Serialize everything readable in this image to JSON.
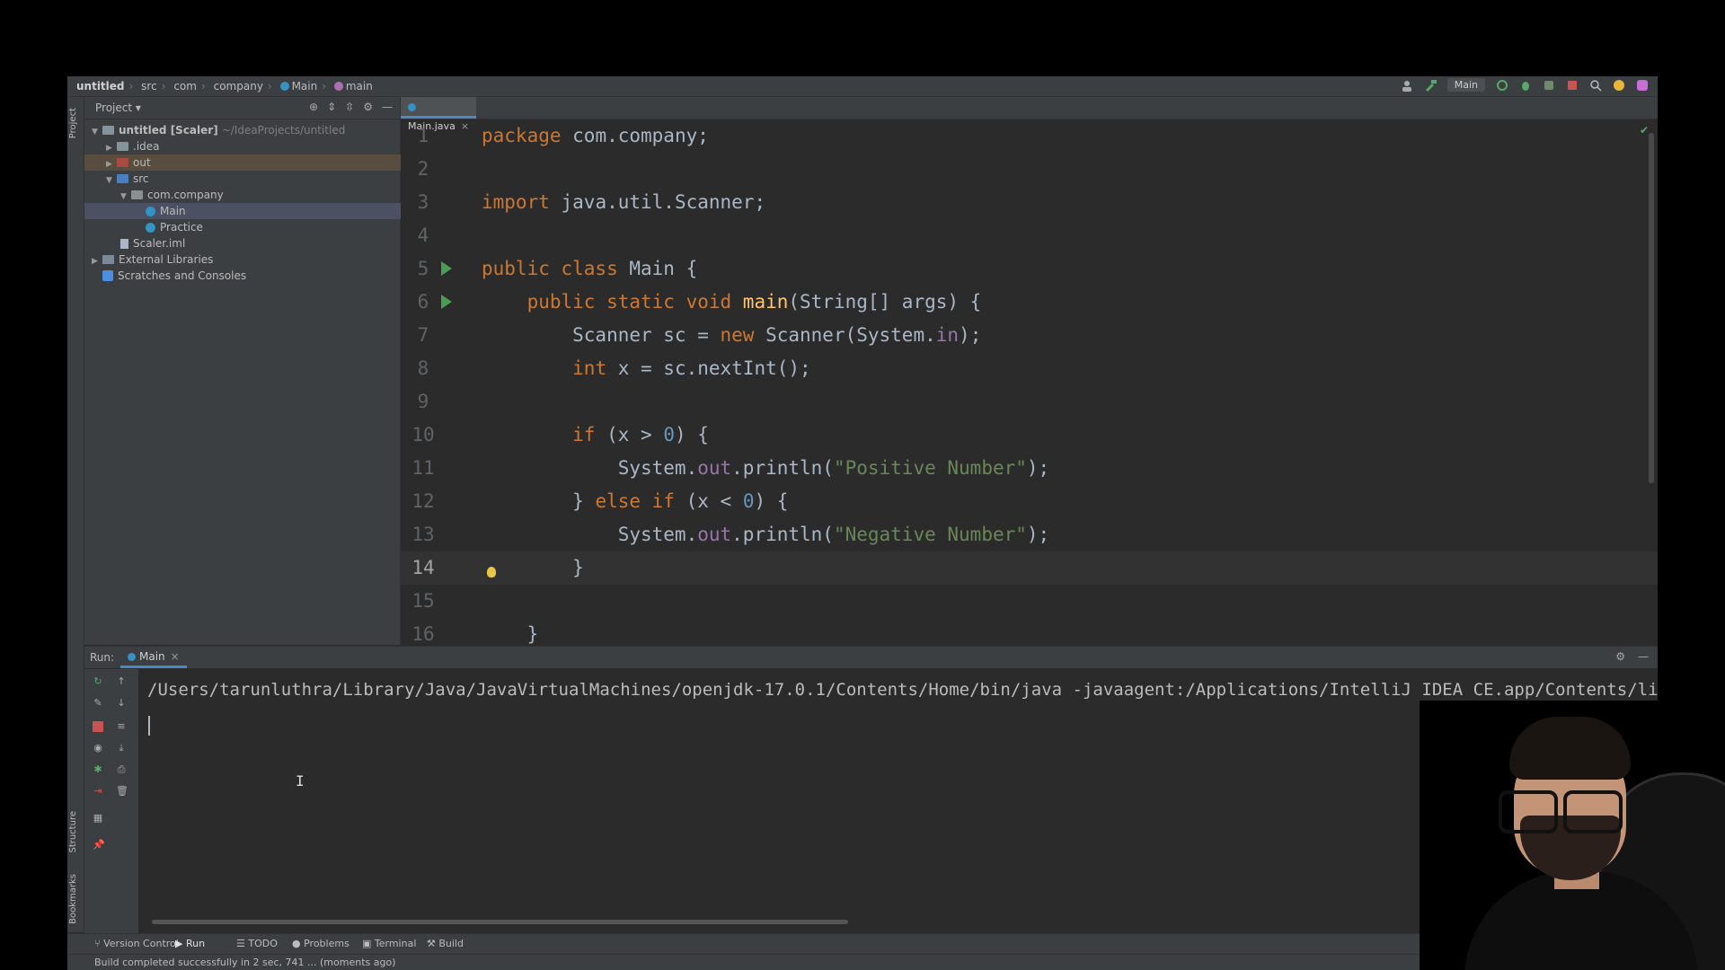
{
  "breadcrumb": [
    "untitled",
    "src",
    "com",
    "company",
    "Main",
    "main"
  ],
  "toolbar": {
    "run_config": "Main"
  },
  "sidebar": {
    "project_label": "Project",
    "structure_label": "Structure",
    "bookmarks_label": "Bookmarks"
  },
  "project": {
    "title": "Project",
    "items": [
      {
        "label": "untitled [Scaler]",
        "extra": "~/IdeaProjects/untitled",
        "icon": "folder-icon"
      },
      {
        "label": ".idea",
        "icon": "folder-icon"
      },
      {
        "label": "out",
        "icon": "folder-icon"
      },
      {
        "label": "src",
        "icon": "folder-icon"
      },
      {
        "label": "com.company",
        "icon": "package-icon"
      },
      {
        "label": "Main",
        "icon": "class-icon"
      },
      {
        "label": "Practice",
        "icon": "class-icon"
      },
      {
        "label": "Scaler.iml",
        "icon": "file-icon"
      },
      {
        "label": "External Libraries",
        "icon": "library-icon"
      },
      {
        "label": "Scratches and Consoles",
        "icon": "scratch-icon"
      }
    ]
  },
  "editor": {
    "tab": "Main.java",
    "current_line": 14,
    "lines": [
      {
        "n": "1",
        "parts": [
          [
            "kw",
            "package "
          ],
          [
            "ty",
            "com.company;"
          ]
        ]
      },
      {
        "n": "2",
        "parts": []
      },
      {
        "n": "3",
        "parts": [
          [
            "kw",
            "import "
          ],
          [
            "ty",
            "java.util.Scanner;"
          ]
        ]
      },
      {
        "n": "4",
        "parts": []
      },
      {
        "n": "5",
        "parts": [
          [
            "kw",
            "public class "
          ],
          [
            "ty",
            "Main {"
          ]
        ]
      },
      {
        "n": "6",
        "parts": [
          [
            "ty",
            "    "
          ],
          [
            "kw",
            "public static void "
          ],
          [
            "fn",
            "main"
          ],
          [
            "ty",
            "(String[] args) {"
          ]
        ]
      },
      {
        "n": "7",
        "parts": [
          [
            "ty",
            "        Scanner sc = "
          ],
          [
            "kw",
            "new "
          ],
          [
            "ty",
            "Scanner(System."
          ],
          [
            "fld",
            "in"
          ],
          [
            "ty",
            ");"
          ]
        ]
      },
      {
        "n": "8",
        "parts": [
          [
            "ty",
            "        "
          ],
          [
            "kw",
            "int "
          ],
          [
            "ty",
            "x = sc.nextInt();"
          ]
        ]
      },
      {
        "n": "9",
        "parts": []
      },
      {
        "n": "10",
        "parts": [
          [
            "ty",
            "        "
          ],
          [
            "kw",
            "if "
          ],
          [
            "ty",
            "(x > "
          ],
          [
            "num",
            "0"
          ],
          [
            "ty",
            ") {"
          ]
        ]
      },
      {
        "n": "11",
        "parts": [
          [
            "ty",
            "            System."
          ],
          [
            "fld",
            "out"
          ],
          [
            "ty",
            ".println("
          ],
          [
            "str",
            "\"Positive Number\""
          ],
          [
            "ty",
            ");"
          ]
        ]
      },
      {
        "n": "12",
        "parts": [
          [
            "ty",
            "        } "
          ],
          [
            "kw",
            "else if "
          ],
          [
            "ty",
            "(x < "
          ],
          [
            "num",
            "0"
          ],
          [
            "ty",
            ") {"
          ]
        ]
      },
      {
        "n": "13",
        "parts": [
          [
            "ty",
            "            System."
          ],
          [
            "fld",
            "out"
          ],
          [
            "ty",
            ".println("
          ],
          [
            "str",
            "\"Negative Number\""
          ],
          [
            "ty",
            ");"
          ]
        ]
      },
      {
        "n": "14",
        "parts": [
          [
            "ty",
            "        }"
          ]
        ]
      },
      {
        "n": "15",
        "parts": []
      },
      {
        "n": "16",
        "parts": [
          [
            "ty",
            "    }"
          ]
        ]
      }
    ]
  },
  "run": {
    "label": "Run:",
    "tab": "Main",
    "command": "/Users/tarunluthra/Library/Java/JavaVirtualMachines/openjdk-17.0.1/Contents/Home/bin/java -javaagent:/Applications/IntelliJ IDEA CE.app/Contents/lib/ide"
  },
  "bottom_tabs": [
    "Version Control",
    "Run",
    "TODO",
    "Problems",
    "Terminal",
    "Build"
  ],
  "status": "Build completed successfully in 2 sec, 741 ... (moments ago)",
  "colors": {
    "keyword": "#cc7832",
    "method": "#ffc66d",
    "string": "#6a8759",
    "number": "#6897bb",
    "field": "#9876aa",
    "text": "#a9b7c6",
    "accent": "#4a88c7"
  }
}
